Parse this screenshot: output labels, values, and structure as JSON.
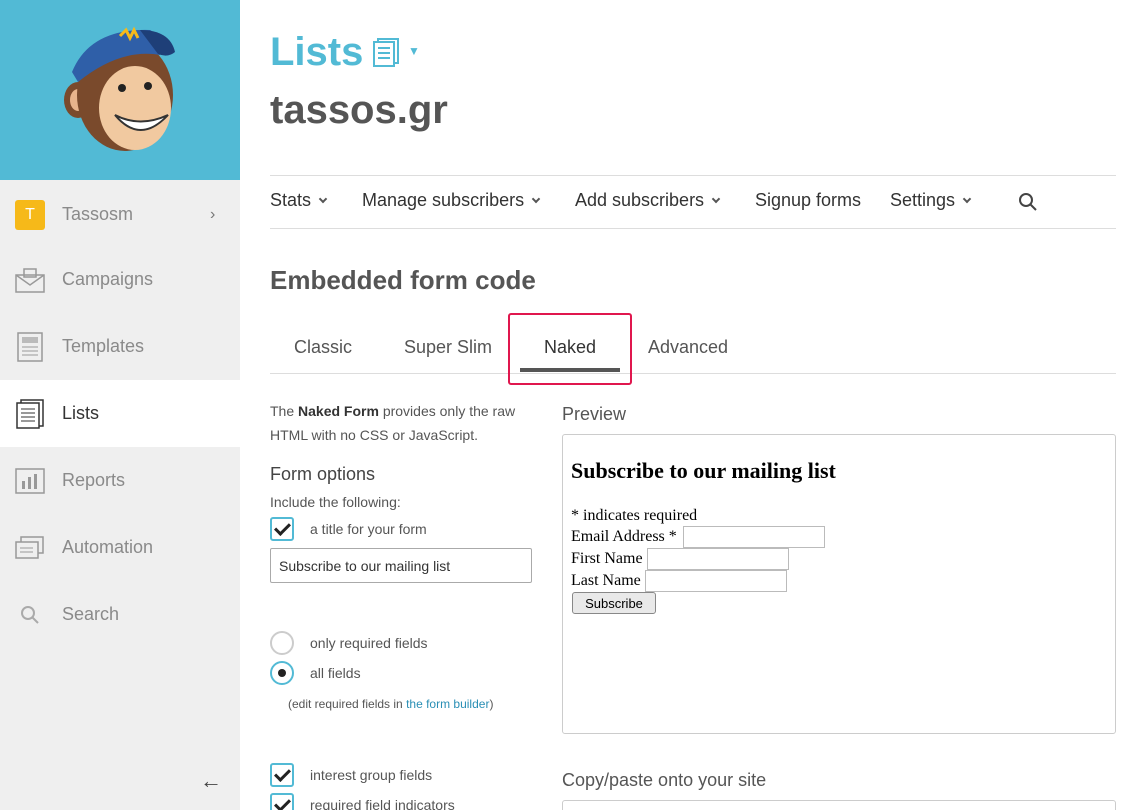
{
  "sidebar": {
    "account": {
      "initial": "T",
      "name": "Tassosm"
    },
    "items": [
      {
        "label": "Campaigns",
        "icon": "campaigns-icon"
      },
      {
        "label": "Templates",
        "icon": "templates-icon"
      },
      {
        "label": "Lists",
        "icon": "lists-icon",
        "active": true
      },
      {
        "label": "Reports",
        "icon": "reports-icon"
      },
      {
        "label": "Automation",
        "icon": "automation-icon"
      },
      {
        "label": "Search",
        "icon": "search-icon"
      }
    ],
    "collapse_glyph": "←",
    "colors": {
      "brand": "#52bad5",
      "badge": "#f6b919"
    }
  },
  "header": {
    "title": "Lists",
    "account_name": "tassos.gr"
  },
  "menu": {
    "stats": "Stats",
    "manage": "Manage subscribers",
    "add": "Add subscribers",
    "signup": "Signup forms",
    "settings": "Settings"
  },
  "section_title": "Embedded form code",
  "tabs": {
    "classic": "Classic",
    "super_slim": "Super Slim",
    "naked": "Naked",
    "advanced": "Advanced",
    "active": "Naked"
  },
  "description": {
    "prefix": "The ",
    "bold": "Naked Form",
    "suffix": " provides only the raw HTML with no CSS or JavaScript."
  },
  "form_options": {
    "heading": "Form options",
    "include_label": "Include the following:",
    "title_checkbox_label": "a title for your form",
    "title_value": "Subscribe to our mailing list",
    "only_required": "only required fields",
    "all_fields": "all fields",
    "edit_note_prefix": "(edit required fields in ",
    "edit_note_link": "the form builder",
    "edit_note_suffix": ")",
    "interest_groups": "interest group fields",
    "required_indicators": "required field indicators"
  },
  "preview": {
    "label": "Preview",
    "title": "Subscribe to our mailing list",
    "required_note": "* indicates required",
    "email_label": "Email Address *",
    "first_name_label": "First Name",
    "last_name_label": "Last Name",
    "button": "Subscribe"
  },
  "copy_label": "Copy/paste onto your site"
}
